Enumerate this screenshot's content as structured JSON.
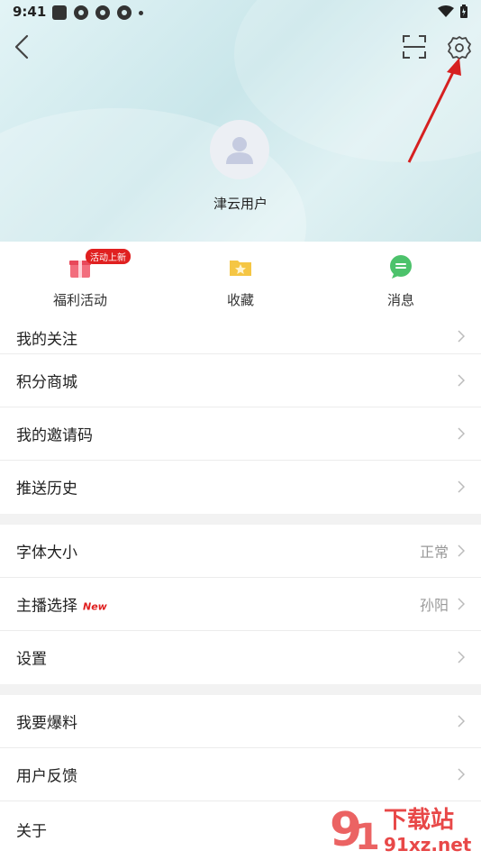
{
  "status": {
    "time": "9:41"
  },
  "profile": {
    "username": "津云用户"
  },
  "quick_actions": [
    {
      "label": "福利活动",
      "badge": "活动上新"
    },
    {
      "label": "收藏"
    },
    {
      "label": "消息"
    }
  ],
  "menu": {
    "partial_top": "我的关注",
    "points_mall": "积分商城",
    "invite_code": "我的邀请码",
    "push_history": "推送历史",
    "font_size": {
      "label": "字体大小",
      "value": "正常"
    },
    "anchor": {
      "label": "主播选择",
      "tag": "New",
      "value": "孙阳"
    },
    "settings": "设置",
    "report": "我要爆料",
    "feedback": "用户反馈",
    "about": "关于"
  },
  "watermark": {
    "brand": "下载站",
    "domain": "91xz.net"
  },
  "colors": {
    "accent_red": "#e02020",
    "hero_bg": "#d6ecee"
  }
}
